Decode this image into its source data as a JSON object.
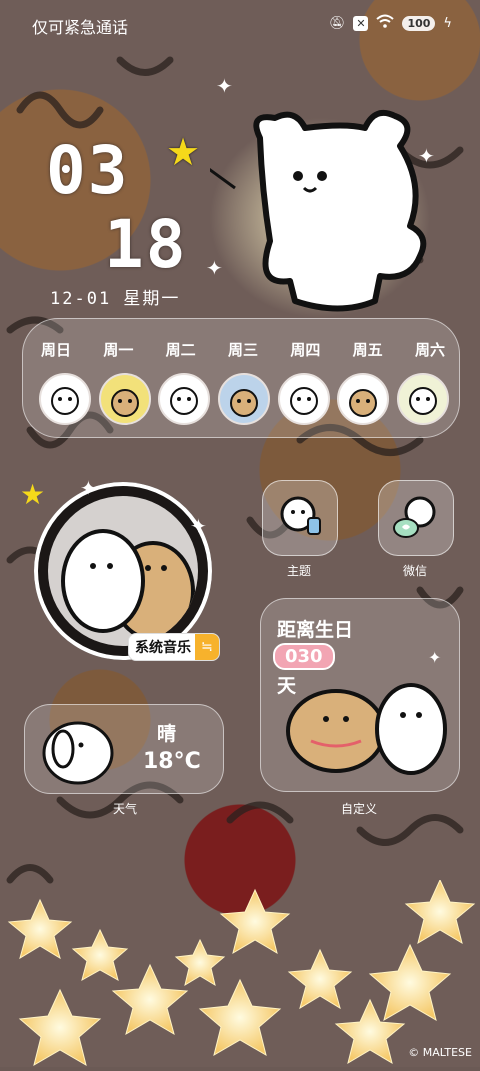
{
  "status": {
    "emergency": "仅可紧急通话",
    "battery": "100"
  },
  "clock": {
    "hour": "03",
    "minute": "18",
    "date": "12-01 星期一"
  },
  "week": {
    "days": [
      "周日",
      "周一",
      "周二",
      "周三",
      "周四",
      "周五",
      "周六"
    ]
  },
  "music": {
    "label": "系统音乐"
  },
  "apps": {
    "theme_label": "主题",
    "wechat_label": "微信"
  },
  "birthday": {
    "line1": "距离生日",
    "days": "030",
    "line2": "天",
    "label": "自定义"
  },
  "weather": {
    "condition": "晴",
    "temp": "18°C",
    "label": "天气"
  },
  "copyright": "© MALTESE",
  "colors": {
    "accent_yellow": "#f7b22c",
    "pink": "#f2a5b3",
    "wall": "#6f5d58"
  }
}
